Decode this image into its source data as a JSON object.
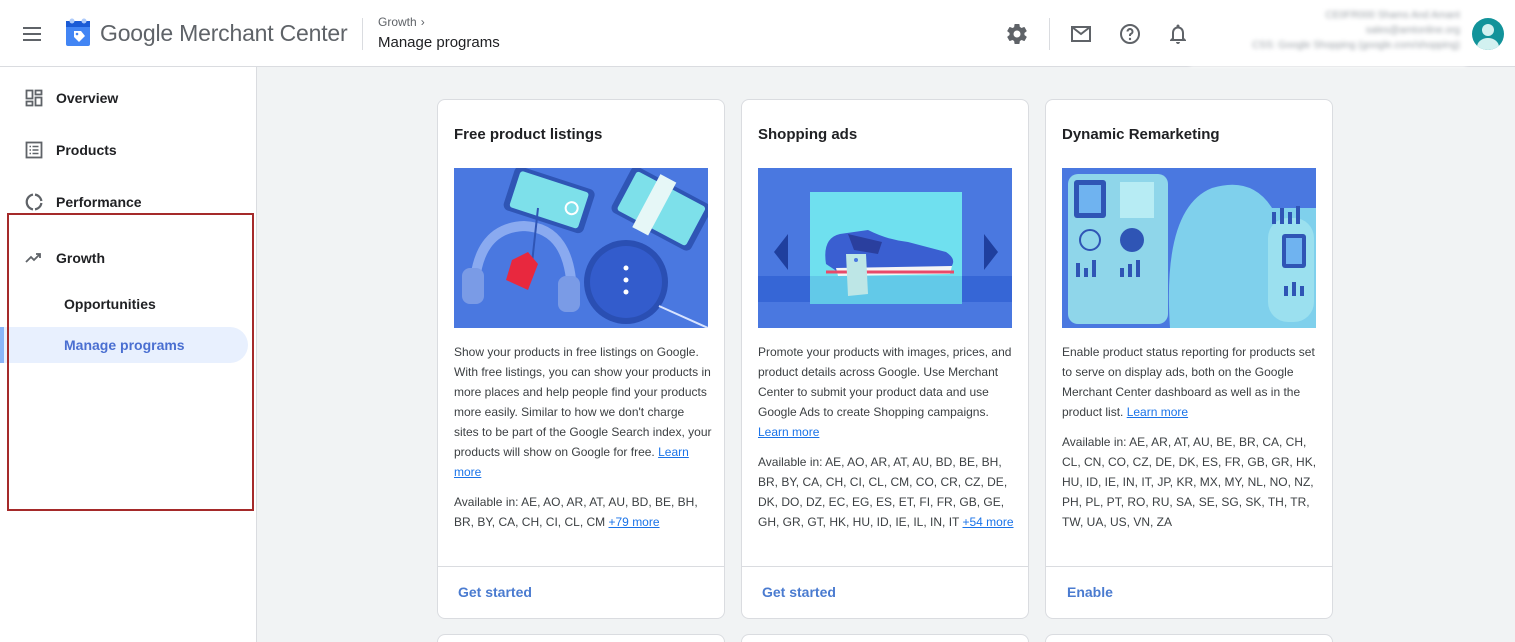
{
  "header": {
    "brand_google": "Google",
    "brand_rest": "Merchant Center",
    "breadcrumb": "Growth",
    "page_title": "Manage programs",
    "account": {
      "line1": "CE0FR000 Shams And Amant",
      "line2": "sales@amtonline.org",
      "line3": "CSS: Google Shopping (google.com/shopping)"
    }
  },
  "sidebar": {
    "items": [
      {
        "label": "Overview",
        "icon": "dashboard-icon"
      },
      {
        "label": "Products",
        "icon": "list-icon"
      },
      {
        "label": "Performance",
        "icon": "donut-chart-icon"
      },
      {
        "label": "Growth",
        "icon": "trending-up-icon"
      }
    ],
    "sub_items": [
      {
        "label": "Opportunities"
      },
      {
        "label": "Manage programs",
        "active": true
      }
    ]
  },
  "cards": [
    {
      "title": "Free product listings",
      "desc": "Show your products in free listings on Google. With free listings, you can show your products in more places and help people find your products more easily. Similar to how we don't charge sites to be part of the Google Search index, your products will show on Google for free.",
      "learn_more": "Learn more",
      "available": "Available in: AE, AO, AR, AT, AU, BD, BE, BH, BR, BY, CA, CH, CI, CL, CM",
      "more": "+79 more",
      "action": "Get started"
    },
    {
      "title": "Shopping ads",
      "desc": "Promote your products with images, prices, and product details across Google. Use Merchant Center to submit your product data and use Google Ads to create Shopping campaigns.",
      "learn_more": "Learn more",
      "available": "Available in: AE, AO, AR, AT, AU, BD, BE, BH, BR, BY, CA, CH, CI, CL, CM, CO, CR, CZ, DE, DK, DO, DZ, EC, EG, ES, ET, FI, FR, GB, GE, GH, GR, GT, HK, HU, ID, IE, IL, IN, IT",
      "more": "+54 more",
      "action": "Get started"
    },
    {
      "title": "Dynamic Remarketing",
      "desc": "Enable product status reporting for products set to serve on display ads, both on the Google Merchant Center dashboard as well as in the product list.",
      "learn_more": "Learn more",
      "available": "Available in: AE, AR, AT, AU, BE, BR, CA, CH, CL, CN, CO, CZ, DE, DK, ES, FR, GB, GR, HK, HU, ID, IE, IN, IT, JP, KR, MX, MY, NL, NO, NZ, PH, PL, PT, RO, RU, SA, SE, SG, SK, TH, TR, TW, UA, US, VN, ZA",
      "more": "",
      "action": "Enable"
    }
  ],
  "colors": {
    "accent": "#4a7bd0",
    "active_bg": "#e8f0fe",
    "highlight": "#a52a2a",
    "avatar": "#12939a"
  }
}
